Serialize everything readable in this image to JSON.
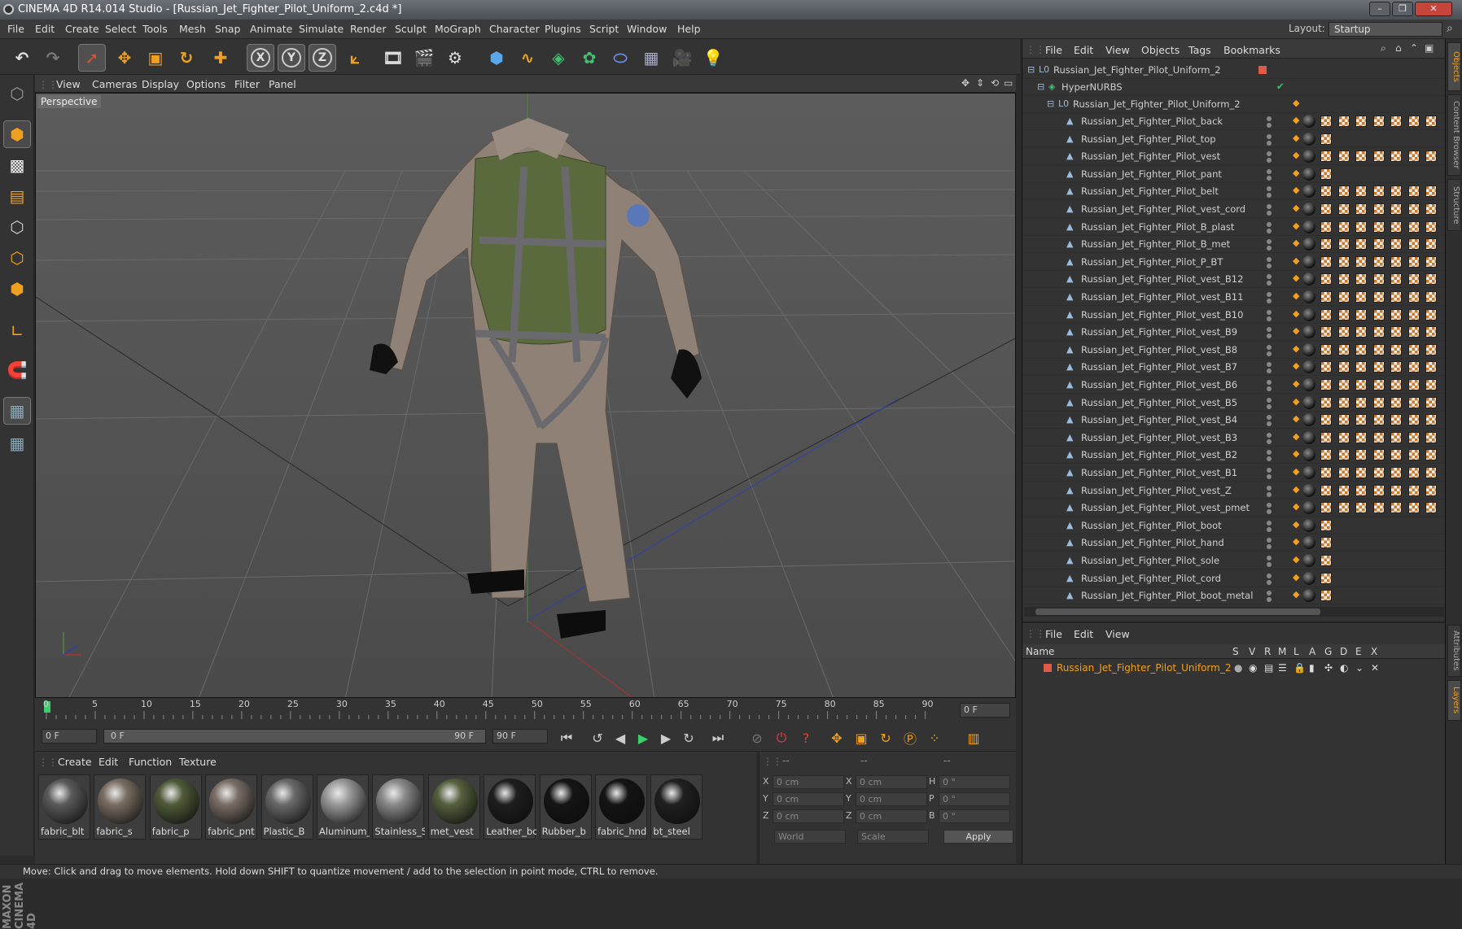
{
  "window": {
    "title": "CINEMA 4D R14.014 Studio - [Russian_Jet_Fighter_Pilot_Uniform_2.c4d *]",
    "min": "–",
    "max": "❐",
    "close": "✕"
  },
  "menubar": {
    "items": [
      "File",
      "Edit",
      "Create",
      "Select",
      "Tools",
      "Mesh",
      "Snap",
      "Animate",
      "Simulate",
      "Render",
      "Sculpt",
      "MoGraph",
      "Character",
      "Plugins",
      "Script",
      "Window",
      "Help"
    ],
    "layout_label": "Layout:",
    "layout_value": "Startup"
  },
  "viewport": {
    "menu": [
      "View",
      "Cameras",
      "Display",
      "Options",
      "Filter",
      "Panel"
    ],
    "label": "Perspective"
  },
  "timeline": {
    "ticks": [
      "0",
      "5",
      "10",
      "15",
      "20",
      "25",
      "30",
      "35",
      "40",
      "45",
      "50",
      "55",
      "60",
      "65",
      "70",
      "75",
      "80",
      "85",
      "90"
    ],
    "current_frame": "0 F"
  },
  "transport": {
    "start": "0 F",
    "range_start": "0 F",
    "range_end": "90 F",
    "end": "90 F"
  },
  "materials": {
    "menu": [
      "Create",
      "Edit",
      "Function",
      "Texture"
    ],
    "items": [
      {
        "name": "fabric_blt",
        "color": "#5a5a5a"
      },
      {
        "name": "fabric_s",
        "color": "#7a6e62"
      },
      {
        "name": "fabric_p",
        "color": "#4f5a38"
      },
      {
        "name": "fabric_pnt",
        "color": "#7a6e66"
      },
      {
        "name": "Plastic_B",
        "color": "#6a6a6a"
      },
      {
        "name": "Aluminum_",
        "color": "#9a9a9a"
      },
      {
        "name": "Stainless_S",
        "color": "#8a8a8a"
      },
      {
        "name": "met_vest",
        "color": "#55603e"
      },
      {
        "name": "Leather_bo",
        "color": "#1e1e1e"
      },
      {
        "name": "Rubber_b",
        "color": "#151515"
      },
      {
        "name": "fabric_hnd",
        "color": "#141414"
      },
      {
        "name": "bt_steel",
        "color": "#202020"
      }
    ]
  },
  "coords": {
    "header": [
      "--",
      "--",
      "--"
    ],
    "rows": [
      {
        "a": "X",
        "av": "0 cm",
        "b": "X",
        "bv": "0 cm",
        "c": "H",
        "cv": "0 °"
      },
      {
        "a": "Y",
        "av": "0 cm",
        "b": "Y",
        "bv": "0 cm",
        "c": "P",
        "cv": "0 °"
      },
      {
        "a": "Z",
        "av": "0 cm",
        "b": "Z",
        "bv": "0 cm",
        "c": "B",
        "cv": "0 °"
      }
    ],
    "world": "World",
    "scale": "Scale",
    "apply": "Apply"
  },
  "objects": {
    "menu": [
      "File",
      "Edit",
      "View",
      "Objects",
      "Tags",
      "Bookmarks"
    ],
    "root": "Russian_Jet_Fighter_Pilot_Uniform_2",
    "hypernurbs": "HyperNURBS",
    "group": "Russian_Jet_Fighter_Pilot_Uniform_2",
    "children": [
      {
        "name": "Russian_Jet_Fighter_Pilot_back",
        "checks": 7
      },
      {
        "name": "Russian_Jet_Fighter_Pilot_top",
        "checks": 1
      },
      {
        "name": "Russian_Jet_Fighter_Pilot_vest",
        "checks": 7
      },
      {
        "name": "Russian_Jet_Fighter_Pilot_pant",
        "checks": 1
      },
      {
        "name": "Russian_Jet_Fighter_Pilot_belt",
        "checks": 7
      },
      {
        "name": "Russian_Jet_Fighter_Pilot_vest_cord",
        "checks": 7
      },
      {
        "name": "Russian_Jet_Fighter_Pilot_B_plast",
        "checks": 7
      },
      {
        "name": "Russian_Jet_Fighter_Pilot_B_met",
        "checks": 7
      },
      {
        "name": "Russian_Jet_Fighter_Pilot_P_BT",
        "checks": 7
      },
      {
        "name": "Russian_Jet_Fighter_Pilot_vest_B12",
        "checks": 7
      },
      {
        "name": "Russian_Jet_Fighter_Pilot_vest_B11",
        "checks": 7
      },
      {
        "name": "Russian_Jet_Fighter_Pilot_vest_B10",
        "checks": 7
      },
      {
        "name": "Russian_Jet_Fighter_Pilot_vest_B9",
        "checks": 7
      },
      {
        "name": "Russian_Jet_Fighter_Pilot_vest_B8",
        "checks": 7
      },
      {
        "name": "Russian_Jet_Fighter_Pilot_vest_B7",
        "checks": 7
      },
      {
        "name": "Russian_Jet_Fighter_Pilot_vest_B6",
        "checks": 7
      },
      {
        "name": "Russian_Jet_Fighter_Pilot_vest_B5",
        "checks": 7
      },
      {
        "name": "Russian_Jet_Fighter_Pilot_vest_B4",
        "checks": 7
      },
      {
        "name": "Russian_Jet_Fighter_Pilot_vest_B3",
        "checks": 7
      },
      {
        "name": "Russian_Jet_Fighter_Pilot_vest_B2",
        "checks": 7
      },
      {
        "name": "Russian_Jet_Fighter_Pilot_vest_B1",
        "checks": 7
      },
      {
        "name": "Russian_Jet_Fighter_Pilot_vest_Z",
        "checks": 7
      },
      {
        "name": "Russian_Jet_Fighter_Pilot_vest_pmet",
        "checks": 7
      },
      {
        "name": "Russian_Jet_Fighter_Pilot_boot",
        "checks": 1
      },
      {
        "name": "Russian_Jet_Fighter_Pilot_hand",
        "checks": 1
      },
      {
        "name": "Russian_Jet_Fighter_Pilot_sole",
        "checks": 1
      },
      {
        "name": "Russian_Jet_Fighter_Pilot_cord",
        "checks": 1
      },
      {
        "name": "Russian_Jet_Fighter_Pilot_boot_metal",
        "checks": 1
      }
    ]
  },
  "layers": {
    "menu": [
      "File",
      "Edit",
      "View"
    ],
    "columns": [
      "Name",
      "S",
      "V",
      "R",
      "M",
      "L",
      "A",
      "G",
      "D",
      "E",
      "X"
    ],
    "row": "Russian_Jet_Fighter_Pilot_Uniform_2"
  },
  "side_tabs": [
    "Objects",
    "Content Browser",
    "Structure",
    "Attributes",
    "Layers"
  ],
  "status": "Move: Click and drag to move elements. Hold down SHIFT to quantize movement / add to the selection in point mode, CTRL to remove.",
  "colors": {
    "accent": "#f0a020",
    "layer_name": "#f0a020",
    "playhead": "#3ad16a"
  }
}
